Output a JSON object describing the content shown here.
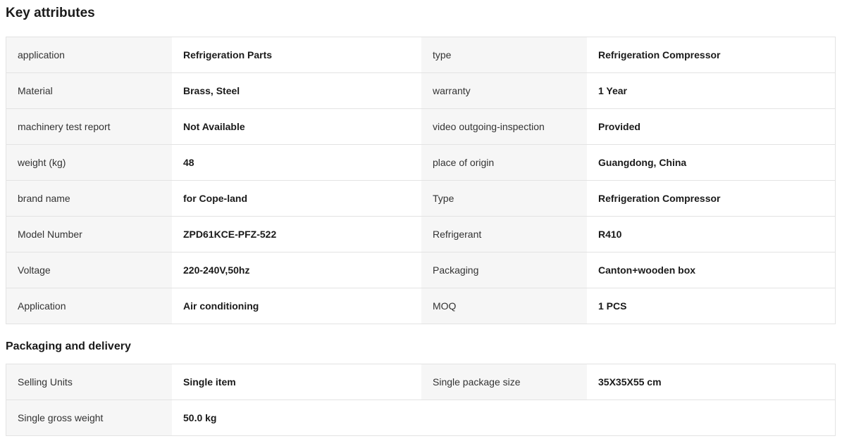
{
  "key_attributes": {
    "title": "Key attributes",
    "rows": [
      {
        "l1": "application",
        "v1": "Refrigeration Parts",
        "l2": "type",
        "v2": "Refrigeration Compressor"
      },
      {
        "l1": "Material",
        "v1": "Brass, Steel",
        "l2": "warranty",
        "v2": "1 Year"
      },
      {
        "l1": "machinery test report",
        "v1": "Not Available",
        "l2": "video outgoing-inspection",
        "v2": "Provided"
      },
      {
        "l1": "weight (kg)",
        "v1": "48",
        "l2": "place of origin",
        "v2": "Guangdong, China"
      },
      {
        "l1": "brand name",
        "v1": "for Cope-land",
        "l2": "Type",
        "v2": "Refrigeration Compressor"
      },
      {
        "l1": "Model Number",
        "v1": "ZPD61KCE-PFZ-522",
        "l2": "Refrigerant",
        "v2": "R410"
      },
      {
        "l1": "Voltage",
        "v1": "220-240V,50hz",
        "l2": "Packaging",
        "v2": "Canton+wooden box"
      },
      {
        "l1": "Application",
        "v1": "Air conditioning",
        "l2": "MOQ",
        "v2": "1 PCS"
      }
    ]
  },
  "packaging_delivery": {
    "title": "Packaging and delivery",
    "rows": [
      {
        "l1": "Selling Units",
        "v1": "Single item",
        "l2": "Single package size",
        "v2": "35X35X55 cm"
      },
      {
        "l1": "Single gross weight",
        "v1": "50.0 kg"
      }
    ]
  }
}
